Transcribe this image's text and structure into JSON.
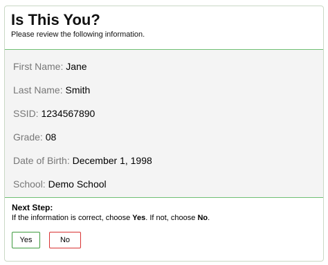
{
  "header": {
    "title": "Is This You?",
    "subtitle": "Please review the following information."
  },
  "student": {
    "first_name": {
      "label": "First Name:",
      "value": "Jane"
    },
    "last_name": {
      "label": "Last Name:",
      "value": "Smith"
    },
    "ssid": {
      "label": "SSID:",
      "value": "1234567890"
    },
    "grade": {
      "label": "Grade:",
      "value": "08"
    },
    "dob": {
      "label": "Date of Birth:",
      "value": "December 1, 1998"
    },
    "school": {
      "label": "School:",
      "value": "Demo School"
    }
  },
  "next_step": {
    "title": "Next Step:",
    "text_before_yes": "If the information is correct, choose ",
    "yes_word": "Yes",
    "text_middle": ". If not, choose ",
    "no_word": "No",
    "text_end": "."
  },
  "buttons": {
    "yes_label": "Yes",
    "no_label": "No"
  },
  "colors": {
    "accent_green": "#3d9a3d",
    "divider_green": "#6fbf73",
    "no_red": "#d83030",
    "info_background": "#f4f4f4"
  }
}
